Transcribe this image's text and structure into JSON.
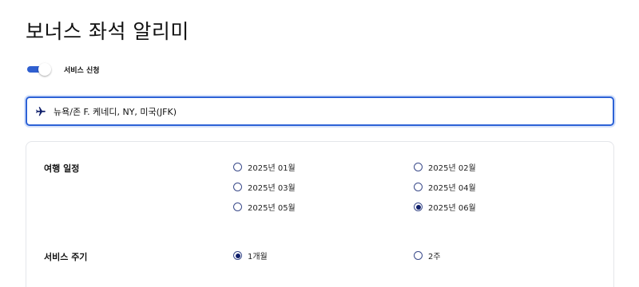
{
  "page": {
    "title": "보너스 좌석 알리미"
  },
  "service_toggle": {
    "label": "서비스 신청",
    "enabled": true
  },
  "destination": {
    "icon": "airplane-icon",
    "value": "뉴욕/존 F. 케네디, NY, 미국(JFK)"
  },
  "travel_schedule": {
    "label": "여행 일정",
    "options": [
      {
        "label": "2025년 01월",
        "checked": false
      },
      {
        "label": "2025년 02월",
        "checked": false
      },
      {
        "label": "2025년 03월",
        "checked": false
      },
      {
        "label": "2025년 04월",
        "checked": false
      },
      {
        "label": "2025년 05월",
        "checked": false
      },
      {
        "label": "2025년 06월",
        "checked": true
      }
    ]
  },
  "service_period": {
    "label": "서비스 주기",
    "options": [
      {
        "label": "1개월",
        "checked": true
      },
      {
        "label": "2주",
        "checked": false
      }
    ]
  },
  "colors": {
    "accent": "#2d62d6",
    "radio_checked": "#0f1f6b"
  }
}
